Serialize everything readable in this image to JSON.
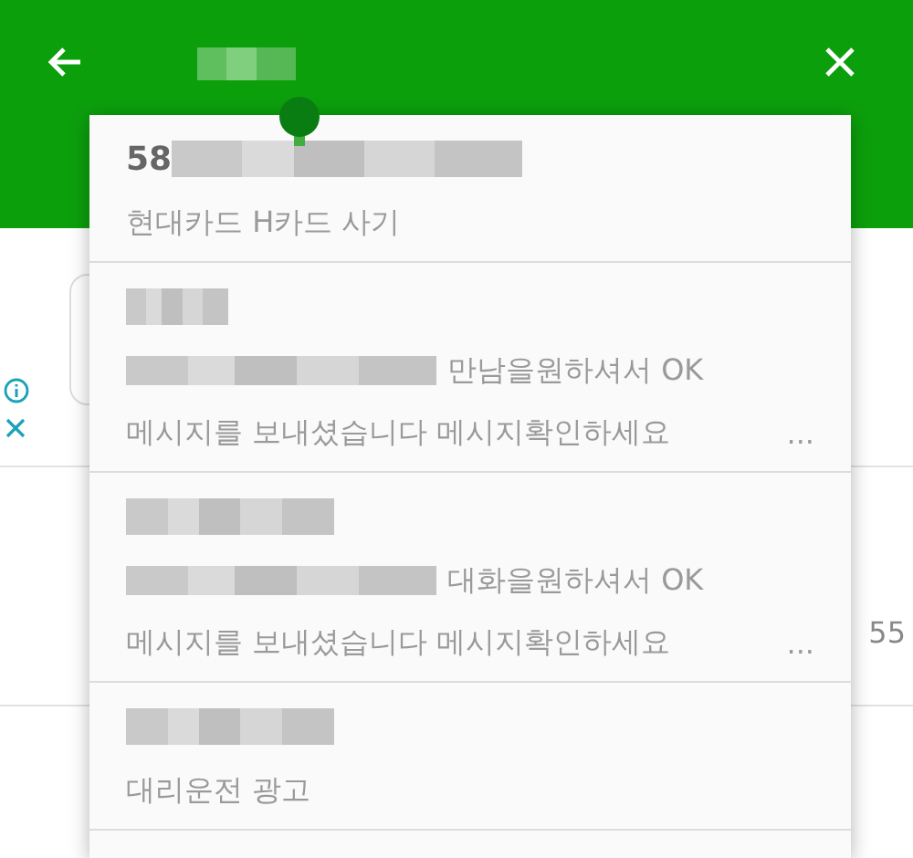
{
  "header": {
    "title_blurred": true
  },
  "background": {
    "reading": "55"
  },
  "popup": {
    "items": [
      {
        "title_prefix": "58",
        "title_blurred": true,
        "lines": [
          {
            "text": "현대카드 H카드 사기"
          }
        ]
      },
      {
        "title_blurred": true,
        "lines": [
          {
            "blurred": true,
            "text": "만남을원하셔서 OK"
          },
          {
            "text": "메시지를 보내셨습니다 메시지확인하세요",
            "suffix": "..."
          }
        ]
      },
      {
        "title_blurred": true,
        "lines": [
          {
            "blurred": true,
            "text": "대화을원하셔서 OK"
          },
          {
            "text": "메시지를 보내셨습니다 메시지확인하세요",
            "suffix": "..."
          }
        ]
      },
      {
        "title_blurred": true,
        "lines": [
          {
            "text": "대리운전 광고"
          }
        ]
      }
    ]
  }
}
